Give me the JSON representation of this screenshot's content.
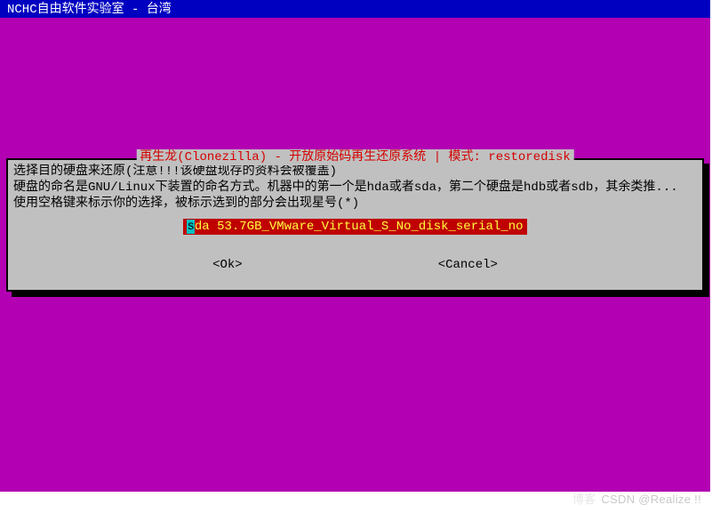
{
  "header": {
    "title": "NCHC自由软件实验室 - 台湾"
  },
  "dialog": {
    "title": "再生龙(Clonezilla) - 开放原始码再生还原系统 | 模式: restoredisk",
    "description": "选择目的硬盘来还原(注意!!!该硬盘现存的资料会被覆盖)\n硬盘的命名是GNU/Linux下装置的命名方式。机器中的第一个是hda或者sda，第二个硬盘是hdb或者sdb，其余类推... 使用空格键来标示你的选择，被标示选到的部分会出现星号(*)",
    "option_highlight": "s",
    "option_rest": "da 53.7GB_VMware_Virtual_S_No_disk_serial_no",
    "ok_label": "<Ok>",
    "cancel_label": "<Cancel>"
  },
  "watermark": {
    "faint": "博客",
    "text": "CSDN @Realize !!"
  }
}
